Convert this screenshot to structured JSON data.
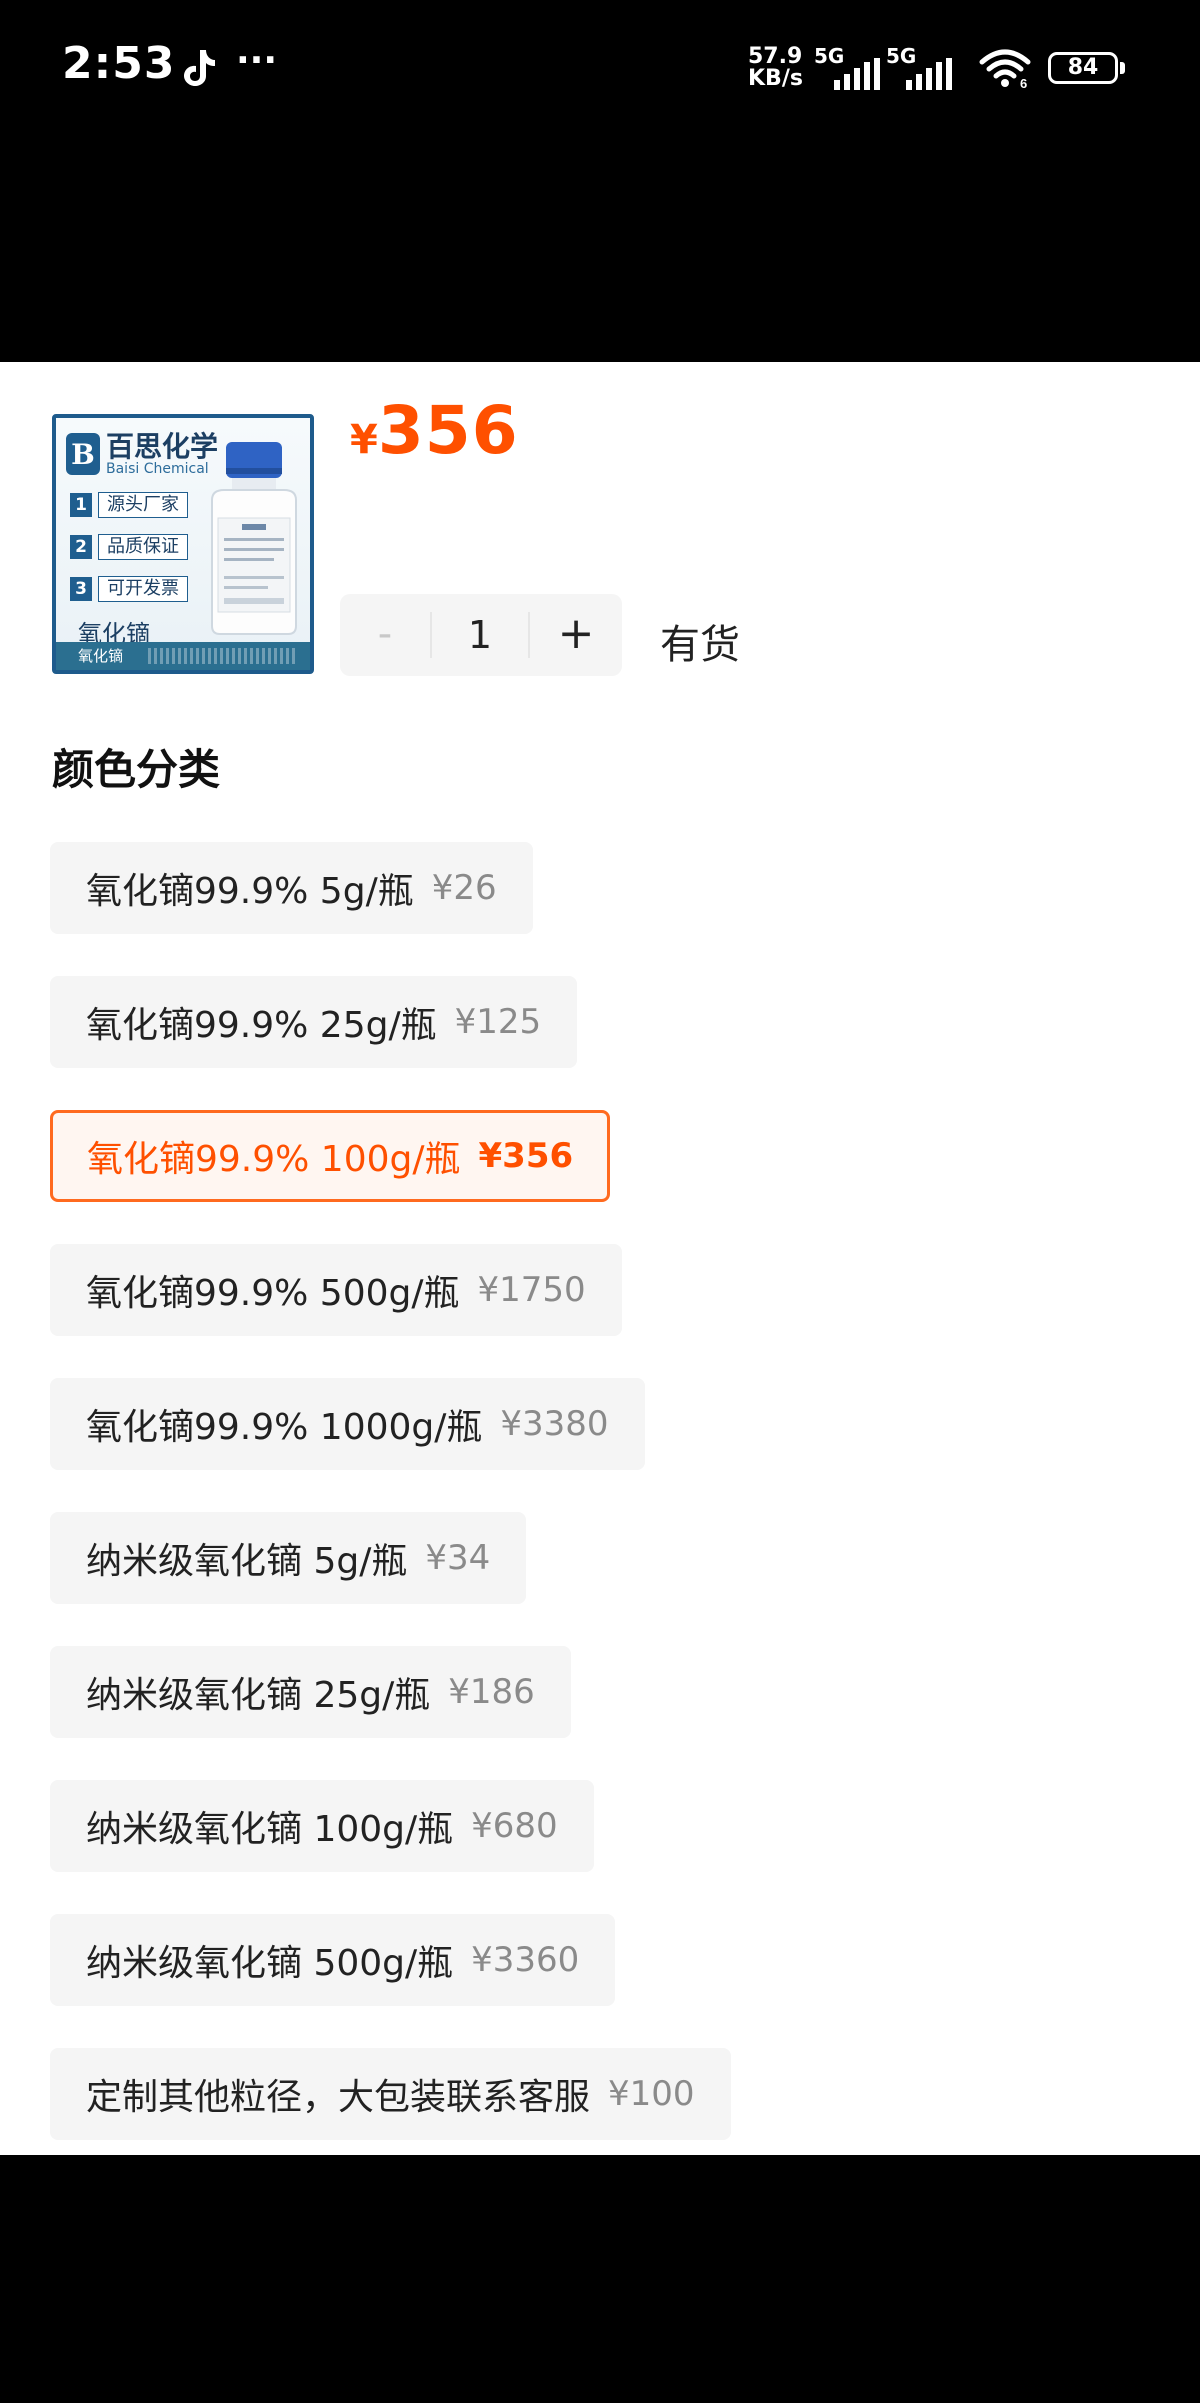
{
  "status_bar": {
    "time": "2:53",
    "app_icon": "tiktok-icon",
    "more": "···",
    "net_speed_value": "57.9",
    "net_speed_unit": "KB/s",
    "signal1_label": "5G",
    "signal2_label": "5G",
    "wifi_badge": "6",
    "battery": "84"
  },
  "product": {
    "thumbnail": {
      "brand_cn": "百思化学",
      "brand_en": "Baisi Chemical",
      "logo_letter": "B",
      "features": [
        {
          "num": "1",
          "text": "源头厂家"
        },
        {
          "num": "2",
          "text": "品质保证"
        },
        {
          "num": "3",
          "text": "可开发票"
        }
      ],
      "product_name": "氧化镝",
      "footer_label": "氧化镝"
    },
    "price_currency": "¥",
    "price_value": "356",
    "quantity": {
      "minus": "-",
      "value": "1",
      "plus": "+"
    },
    "stock_status": "有货"
  },
  "options_section": {
    "title": "颜色分类",
    "options": [
      {
        "name": "氧化镝99.9% 5g/瓶",
        "price": "¥26",
        "selected": false
      },
      {
        "name": "氧化镝99.9%  25g/瓶",
        "price": "¥125",
        "selected": false
      },
      {
        "name": "氧化镝99.9%  100g/瓶",
        "price": "¥356",
        "selected": true
      },
      {
        "name": "氧化镝99.9% 500g/瓶",
        "price": "¥1750",
        "selected": false
      },
      {
        "name": "氧化镝99.9% 1000g/瓶",
        "price": "¥3380",
        "selected": false
      },
      {
        "name": "纳米级氧化镝 5g/瓶",
        "price": "¥34",
        "selected": false
      },
      {
        "name": "纳米级氧化镝 25g/瓶",
        "price": "¥186",
        "selected": false
      },
      {
        "name": "纳米级氧化镝 100g/瓶",
        "price": "¥680",
        "selected": false
      },
      {
        "name": "纳米级氧化镝 500g/瓶",
        "price": "¥3360",
        "selected": false
      },
      {
        "name": "定制其他粒径，大包装联系客服",
        "price": "¥100",
        "selected": false
      }
    ]
  },
  "colors": {
    "accent": "#ff5000",
    "selected_border": "#ff6a1f",
    "option_bg": "#f5f5f5",
    "brand_blue": "#1f5e8f"
  }
}
